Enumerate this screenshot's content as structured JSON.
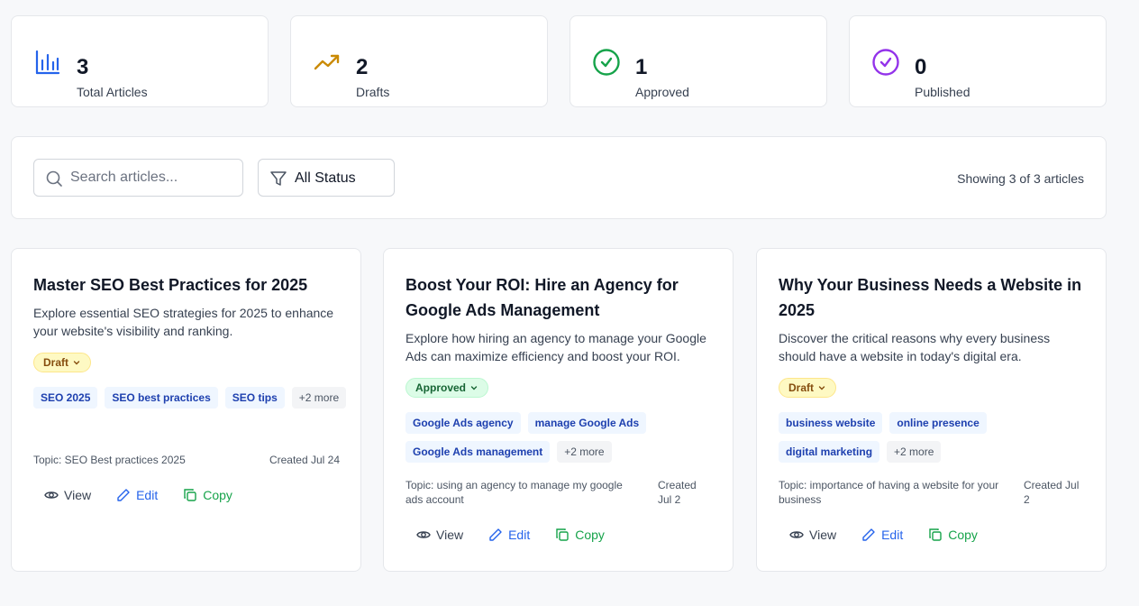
{
  "stats": [
    {
      "value": "3",
      "label": "Total Articles",
      "icon": "bar-chart-icon",
      "color": "#2563eb"
    },
    {
      "value": "2",
      "label": "Drafts",
      "icon": "trending-up-icon",
      "color": "#ca8a04"
    },
    {
      "value": "1",
      "label": "Approved",
      "icon": "check-circle-icon",
      "color": "#16a34a"
    },
    {
      "value": "0",
      "label": "Published",
      "icon": "check-circle-icon",
      "color": "#9333ea"
    }
  ],
  "toolbar": {
    "search_placeholder": "Search articles...",
    "status_filter": "All Status",
    "showing": "Showing 3 of 3 articles"
  },
  "articles": [
    {
      "title": "Master SEO Best Practices for 2025",
      "description": "Explore essential SEO strategies for 2025 to enhance your website's visibility and ranking.",
      "status": "Draft",
      "tags": [
        "SEO 2025",
        "SEO best practices",
        "SEO tips"
      ],
      "more": "+2 more",
      "topic": "Topic: SEO Best practices 2025",
      "created": "Created Jul 24",
      "actions": {
        "view": "View",
        "edit": "Edit",
        "copy": "Copy"
      }
    },
    {
      "title": "Boost Your ROI: Hire an Agency for Google Ads Management",
      "description": "Explore how hiring an agency to manage your Google Ads can maximize efficiency and boost your ROI.",
      "status": "Approved",
      "tags": [
        "Google Ads agency",
        "manage Google Ads",
        "Google Ads management"
      ],
      "more": "+2 more",
      "topic": "Topic: using an agency to manage my google ads account",
      "created": "Created Jul 2",
      "actions": {
        "view": "View",
        "edit": "Edit",
        "copy": "Copy"
      }
    },
    {
      "title": "Why Your Business Needs a Website in 2025",
      "description": "Discover the critical reasons why every business should have a website in today's digital era.",
      "status": "Draft",
      "tags": [
        "business website",
        "online presence",
        "digital marketing"
      ],
      "more": "+2 more",
      "topic": "Topic: importance of having a website for your business",
      "created": "Created Jul 2",
      "actions": {
        "view": "View",
        "edit": "Edit",
        "copy": "Copy"
      }
    }
  ]
}
